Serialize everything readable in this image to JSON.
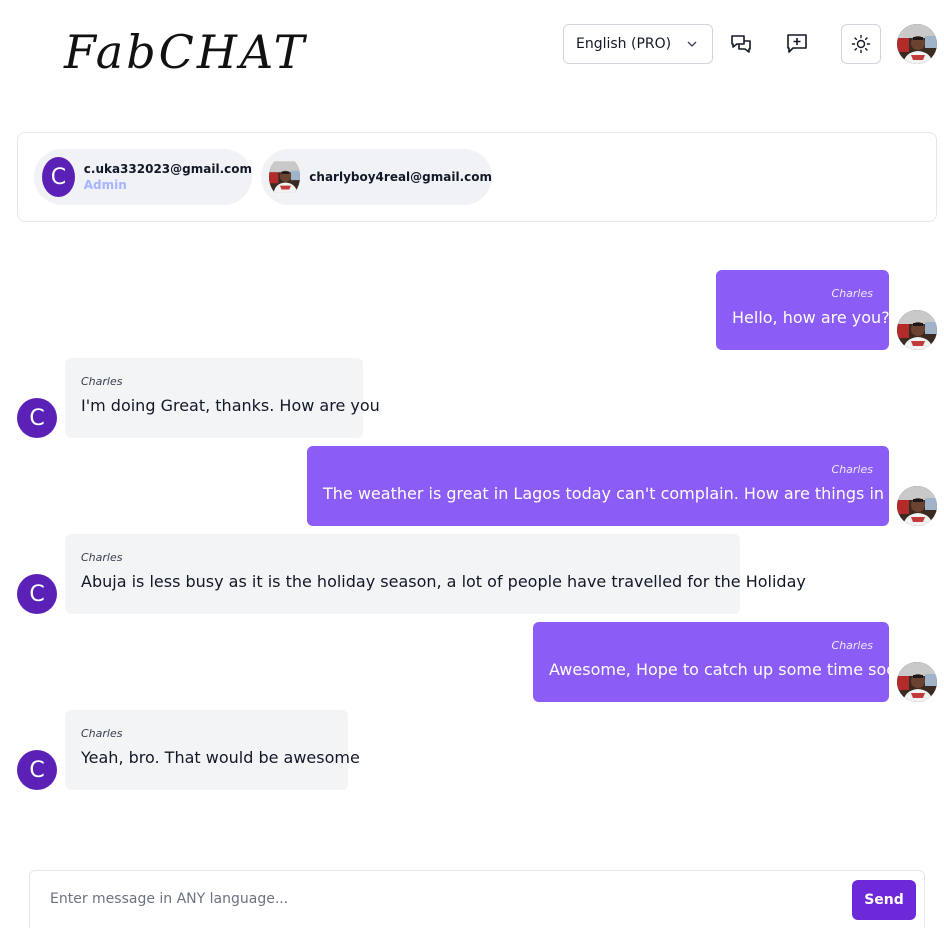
{
  "header": {
    "logo": "FabCHAT",
    "language": "English (PRO)",
    "icons": [
      "chats-icon",
      "new-chat-icon",
      "sun-icon"
    ]
  },
  "participants": [
    {
      "avatar_letter": "C",
      "email": "c.uka332023@gmail.com",
      "role": "Admin"
    },
    {
      "email": "charlyboy4real@gmail.com"
    }
  ],
  "messages": [
    {
      "side": "mine",
      "sender": "Charles",
      "text": "Hello, how are you?"
    },
    {
      "side": "theirs",
      "sender": "Charles",
      "text": "I'm doing Great, thanks. How are you",
      "avatar_letter": "C"
    },
    {
      "side": "mine",
      "sender": "Charles",
      "text": "The weather is great in Lagos today can't complain. How are things in Abuja?"
    },
    {
      "side": "theirs",
      "sender": "Charles",
      "text": "Abuja is less busy as it is the holiday season, a lot of people have travelled for the Holiday",
      "avatar_letter": "C"
    },
    {
      "side": "mine",
      "sender": "Charles",
      "text": "Awesome, Hope to catch up some time soon."
    },
    {
      "side": "theirs",
      "sender": "Charles",
      "text": "Yeah, bro. That would be awesome",
      "avatar_letter": "C"
    }
  ],
  "composer": {
    "placeholder": "Enter message in ANY language...",
    "value": "",
    "send_label": "Send"
  },
  "colors": {
    "mine_bubble": "#8b5cf6",
    "theirs_bubble": "#f3f4f6",
    "letter_avatar": "#5b21b6",
    "send_button": "#6d28d9",
    "admin_role": "#a5b4fc"
  }
}
